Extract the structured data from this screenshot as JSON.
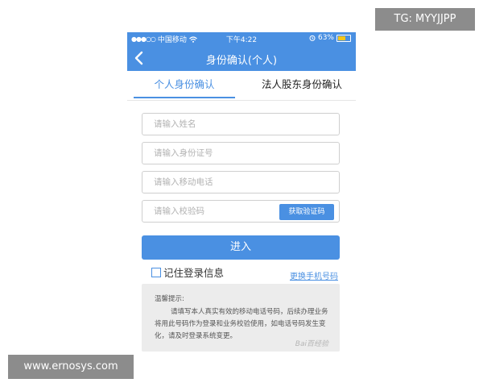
{
  "status_bar": {
    "carrier": "中国移动",
    "time": "下午4:22",
    "battery_percent": "63%",
    "battery_level": 0.63,
    "icons": [
      "signal-dots-icon",
      "wifi-icon",
      "alarm-icon",
      "battery-icon"
    ]
  },
  "nav": {
    "title": "身份确认(个人)",
    "back_icon": "chevron-left-icon"
  },
  "tabs": [
    {
      "label": "个人身份确认",
      "active": true
    },
    {
      "label": "法人股东身份确认",
      "active": false
    }
  ],
  "form": {
    "name_placeholder": "请输入姓名",
    "id_placeholder": "请输入身份证号",
    "phone_placeholder": "请输入移动电话",
    "code_placeholder": "请输入校验码",
    "get_code_label": "获取验证码",
    "submit_label": "进入",
    "remember_label": "记住登录信息",
    "remember_checked": false,
    "change_phone_label": "更换手机号码"
  },
  "tips": {
    "title": "温馨提示:",
    "body": "请填写本人真实有效的移动电话号码，后续办理业务将用此号码作为登录和业务校验使用，如电话号码发生变化，请及时登录系统变更。"
  },
  "watermarks": {
    "tg": "TG: MYYJJPP",
    "site": "www.ernosys.com",
    "baidu": "Bai百经验"
  },
  "colors": {
    "brand": "#4a90e2",
    "tips_bg": "#ececec",
    "badge_bg": "#8c8c8c"
  }
}
